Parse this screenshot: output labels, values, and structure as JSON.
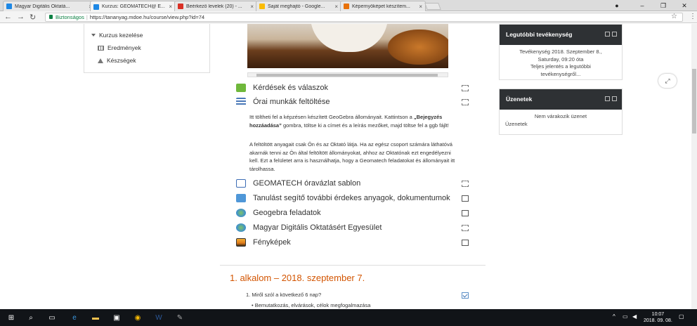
{
  "browser": {
    "tabs": [
      {
        "title": "Magyar Digitális Oktatá...",
        "favicon_color": "#1e88e5"
      },
      {
        "title": "Kurzus: GEOMATECH@ E...",
        "favicon_color": "#1e88e5"
      },
      {
        "title": "Beérkező levelek (20) - ...",
        "favicon_color": "#d93025"
      },
      {
        "title": "Saját meghajtó - Google...",
        "favicon_color": "#fbbc04"
      },
      {
        "title": "Képernyőképet készítem...",
        "favicon_color": "#e8710a"
      }
    ],
    "address": {
      "secure_label": "Biztonságos",
      "url": "https://tananyag.mdoe.hu/course/view.php?id=74"
    }
  },
  "left_block": {
    "header": "Kurzus kezelése",
    "items": [
      "Eredmények",
      "Készségek"
    ]
  },
  "activities": [
    {
      "label": "Kérdések és válaszok",
      "icon": "forum-icon",
      "checkbox": "dashed"
    },
    {
      "label": "Órai munkák feltöltése",
      "icon": "assignment-icon",
      "checkbox": "dashed"
    }
  ],
  "description": {
    "p1_a": "Itt töltheti fel a képzésen készített GeoGebra állományait. Kattintson a ",
    "p1_bold": "„Bejegyzés hozzáadása”",
    "p1_b": " gombra, töltse ki a címet és a leírás mezőket, majd töltse fel a ggb fájlt!",
    "p2": "A feltöltött anyagait csak Ön és az Oktató látja. Ha az egész csoport számára láthatóvá akarnák tenni az Ön által feltöltött állományokat, ahhoz az Oktatónak ezt engedélyezni kell. Ezt a felületet arra is használhatja, hogy a Geomatech feladatokat és állományait itt tárolhassa."
  },
  "more_activities": [
    {
      "label": "GEOMATECH óravázlat sablon",
      "icon": "word-doc-icon",
      "checkbox": "dashed"
    },
    {
      "label": "Tanulást segítő további érdekes anyagok, dokumentumok",
      "icon": "folder-icon",
      "checkbox": "solid"
    },
    {
      "label": "Geogebra feladatok",
      "icon": "url-globe-icon",
      "checkbox": "solid"
    },
    {
      "label": "Magyar Digitális Oktatásért Egyesület",
      "icon": "url-globe-icon",
      "checkbox": "dashed"
    },
    {
      "label": "Fényképek",
      "icon": "image-icon",
      "checkbox": "solid"
    }
  ],
  "section": {
    "title": "1. alkalom – 2018. szeptember 7.",
    "question": "1.  Miről szól a következő 6 nap?",
    "bullet": "Bemutatkozás, elvárások, célok megfogalmazása"
  },
  "recent_activity": {
    "title": "Legutóbbi tevékenység",
    "lines": [
      "Tevékenység 2018. Szeptember 8.,",
      "Saturday, 09:20 óta",
      "Teljes jelentés a legutóbbi",
      "tevékenységről..."
    ]
  },
  "messages": {
    "title": "Üzenetek",
    "empty": "Nem várakozik üzenet",
    "link": "Üzenetek"
  },
  "taskbar": {
    "time": "10:07",
    "date": "2018. 09. 08."
  },
  "colors": {
    "accent_orange": "#d35400",
    "block_header": "#2e3134"
  }
}
